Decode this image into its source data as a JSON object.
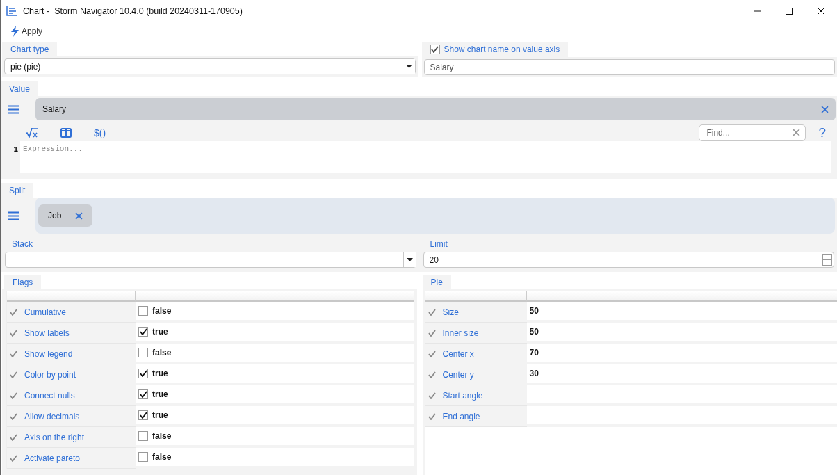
{
  "window": {
    "title": "Chart -  Storm Navigator 10.4.0 (build 20240311-170905)"
  },
  "toolbar": {
    "apply_label": "Apply"
  },
  "chart_type": {
    "tab": "Chart type",
    "value": "pie (pie)"
  },
  "chart_name": {
    "label": "Show chart name on value axis",
    "checked": true,
    "value": "Salary"
  },
  "value": {
    "tab": "Value",
    "item": "Salary",
    "dollar_button": "$()",
    "find_placeholder": "Find...",
    "help": "?",
    "line_number": "1",
    "expression_placeholder": "Expression..."
  },
  "split": {
    "tab": "Split",
    "chips": [
      "Job"
    ]
  },
  "stack": {
    "label": "Stack"
  },
  "limit": {
    "label": "Limit",
    "value": "20"
  },
  "flags": {
    "tab": "Flags",
    "rows": [
      {
        "label": "Cumulative",
        "checked": false,
        "value": "false"
      },
      {
        "label": "Show labels",
        "checked": true,
        "value": "true"
      },
      {
        "label": "Show legend",
        "checked": false,
        "value": "false"
      },
      {
        "label": "Color by point",
        "checked": true,
        "value": "true"
      },
      {
        "label": "Connect nulls",
        "checked": true,
        "value": "true"
      },
      {
        "label": "Allow decimals",
        "checked": true,
        "value": "true"
      },
      {
        "label": "Axis on the right",
        "checked": false,
        "value": "false"
      },
      {
        "label": "Activate pareto",
        "checked": false,
        "value": "false"
      }
    ]
  },
  "pie": {
    "tab": "Pie",
    "rows": [
      {
        "label": "Size",
        "value": "50"
      },
      {
        "label": "Inner size",
        "value": "50"
      },
      {
        "label": "Center x",
        "value": "70"
      },
      {
        "label": "Center y",
        "value": "30"
      },
      {
        "label": "Start angle"
      },
      {
        "label": "End angle"
      }
    ]
  }
}
